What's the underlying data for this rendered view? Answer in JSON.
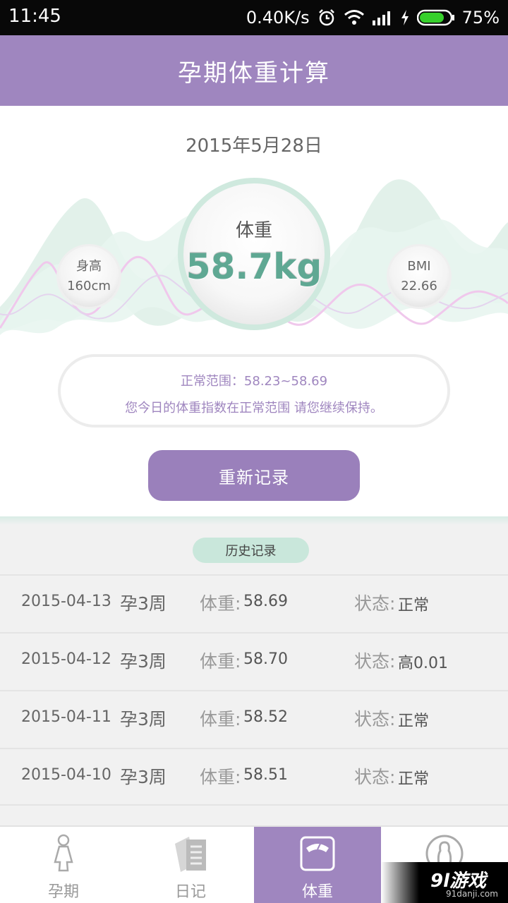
{
  "status_bar": {
    "time": "11:45",
    "speed": "0.40K/s",
    "battery": "75%"
  },
  "header": {
    "title": "孕期体重计算"
  },
  "summary": {
    "date": "2015年5月28日",
    "weight_label": "体重",
    "weight_value": "58.7kg",
    "height_label": "身高",
    "height_value": "160cm",
    "bmi_label": "BMI",
    "bmi_value": "22.66",
    "range_text": "正常范围：58.23~58.69",
    "range_message": "您今日的体重指数在正常范围 请您继续保持。",
    "record_button": "重新记录"
  },
  "history": {
    "title": "历史记录",
    "weight_label": "体重:",
    "status_label": "状态:",
    "rows": [
      {
        "date": "2015-04-13",
        "week": "孕3周",
        "weight": "58.69",
        "status": "正常"
      },
      {
        "date": "2015-04-12",
        "week": "孕3周",
        "weight": "58.70",
        "status": "高0.01"
      },
      {
        "date": "2015-04-11",
        "week": "孕3周",
        "weight": "58.52",
        "status": "正常"
      },
      {
        "date": "2015-04-10",
        "week": "孕3周",
        "weight": "58.51",
        "status": "正常"
      }
    ]
  },
  "bottom_nav": {
    "items": [
      {
        "label": "孕期",
        "icon": "pregnant-woman-icon"
      },
      {
        "label": "日记",
        "icon": "diary-icon"
      },
      {
        "label": "体重",
        "icon": "scale-icon",
        "active": true
      },
      {
        "label": "",
        "icon": "profile-icon"
      }
    ]
  },
  "watermark": {
    "main": "9l游戏",
    "sub": "91danji.com"
  },
  "colors": {
    "primary": "#9f86bf",
    "accent_green": "#5fa893",
    "light_green": "#c9e7db"
  }
}
